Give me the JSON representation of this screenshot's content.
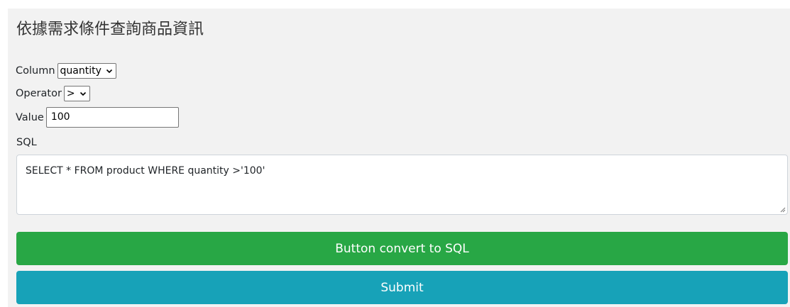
{
  "page": {
    "title": "依據需求條件查詢商品資訊"
  },
  "form": {
    "column": {
      "label": "Column",
      "selected": "quantity"
    },
    "operator": {
      "label": "Operator",
      "selected": ">"
    },
    "value": {
      "label": "Value",
      "value": "100"
    },
    "sql": {
      "label": "SQL",
      "value": "SELECT * FROM product WHERE quantity >'100'"
    }
  },
  "buttons": {
    "convert_label": "Button convert to SQL",
    "submit_label": "Submit"
  },
  "colors": {
    "convert": "#28a745",
    "submit": "#17a2b8",
    "panel": "#f2f2f2"
  },
  "icons": {
    "select_chevron": "chevron-down-icon",
    "textarea_resize": "resize-grip-icon"
  }
}
